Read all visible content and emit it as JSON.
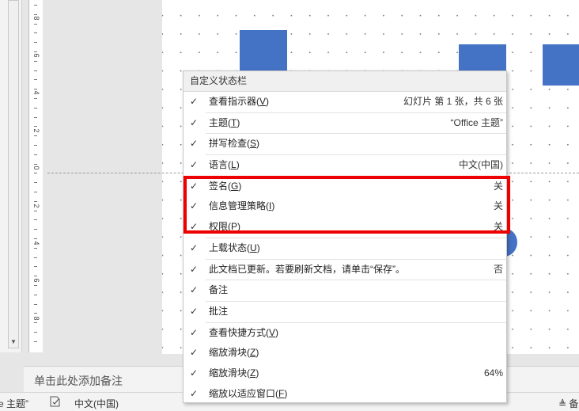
{
  "colors": {
    "shape": "#4472c4",
    "highlight": "#ee0000",
    "menu_bg": "#ffffff",
    "header_bg": "#f0f0f0"
  },
  "ruler": {
    "labels": [
      "8",
      "6",
      "4",
      "2",
      "0",
      "2",
      "4",
      "6",
      "8"
    ]
  },
  "notes": {
    "placeholder": "单击此处添加备注"
  },
  "statusbar": {
    "theme": "ce 主题”",
    "language": "中文(中国)",
    "notes": "备"
  },
  "menu": {
    "title": "自定义状态栏",
    "items": [
      {
        "label": "查看指示器",
        "key": "V",
        "value": "幻灯片 第 1 张，共 6 张",
        "checked": true
      },
      {
        "label": "主题",
        "key": "T",
        "value": "“Office 主题”",
        "checked": true
      },
      {
        "label": "拼写检查",
        "key": "S",
        "value": "",
        "checked": true
      },
      {
        "label": "语言",
        "key": "L",
        "value": "中文(中国)",
        "checked": true
      },
      {
        "label": "签名",
        "key": "G",
        "value": "关",
        "checked": true
      },
      {
        "label": "信息管理策略",
        "key": "I",
        "value": "关",
        "checked": true
      },
      {
        "label": "权限",
        "key": "P",
        "value": "关",
        "checked": true
      },
      {
        "label": "上载状态",
        "key": "U",
        "value": "",
        "checked": true
      },
      {
        "label": "此文档已更新。若要刷新文档，请单击“保存”。",
        "key": "",
        "value": "否",
        "checked": true
      },
      {
        "label": "备注",
        "key": "",
        "value": "",
        "checked": true
      },
      {
        "label": "批注",
        "key": "",
        "value": "",
        "checked": true
      },
      {
        "label": "查看快捷方式",
        "key": "V",
        "value": "",
        "checked": true
      },
      {
        "label": "缩放滑块",
        "key": "Z",
        "value": "",
        "checked": true
      },
      {
        "label": "缩放滑块",
        "key": "Z",
        "value": "64%",
        "checked": true
      },
      {
        "label": "缩放以适应窗口",
        "key": "F",
        "value": "",
        "checked": true
      }
    ]
  }
}
